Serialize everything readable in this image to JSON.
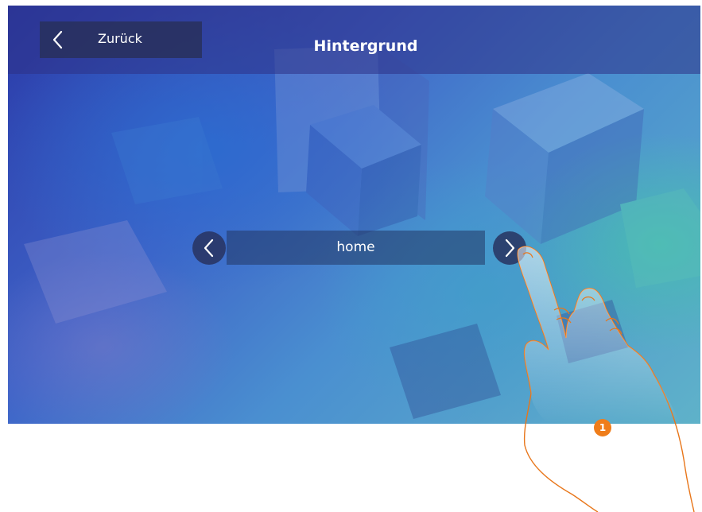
{
  "header": {
    "back_label": "Zurück",
    "title": "Hintergrund"
  },
  "background_selector": {
    "current_value": "home"
  },
  "callout": {
    "step_number": "1"
  },
  "colors": {
    "callout_orange": "#ef7d1a",
    "hand_outline": "#e8761a",
    "topbar": "#2d3287",
    "button_bg": "#28305c"
  },
  "icons": {
    "back": "chevron-left-icon",
    "prev": "chevron-left-icon",
    "next": "chevron-right-icon"
  }
}
